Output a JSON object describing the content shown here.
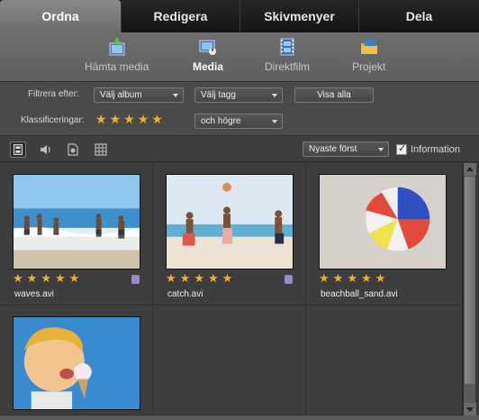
{
  "tabs": [
    {
      "label": "Ordna"
    },
    {
      "label": "Redigera"
    },
    {
      "label": "Skivmenyer"
    },
    {
      "label": "Dela"
    }
  ],
  "subnav": [
    {
      "label": "Hämta media",
      "icon": "get-media-icon"
    },
    {
      "label": "Media",
      "icon": "media-icon"
    },
    {
      "label": "Direktfilm",
      "icon": "instant-movie-icon"
    },
    {
      "label": "Projekt",
      "icon": "project-folder-icon"
    }
  ],
  "filters": {
    "filter_label": "Filtrera efter:",
    "album_select": "Välj album",
    "tag_select": "Välj tagg",
    "show_all": "Visa alla",
    "rating_label": "Klassificeringar:",
    "rating_stars": 5,
    "rating_mode": "och högre"
  },
  "view": {
    "sort_select": "Nyaste först",
    "information_label": "Information",
    "information_checked": true
  },
  "media": [
    {
      "name": "waves.avi",
      "stars": 5,
      "icon": "tag-icon"
    },
    {
      "name": "catch.avi",
      "stars": 5,
      "icon": "tag-icon"
    },
    {
      "name": "beachball_sand.avi",
      "stars": 5
    },
    {
      "name": ""
    }
  ],
  "colors": {
    "accent_star": "#f0b020",
    "active_tab": "#7a7a7a"
  }
}
